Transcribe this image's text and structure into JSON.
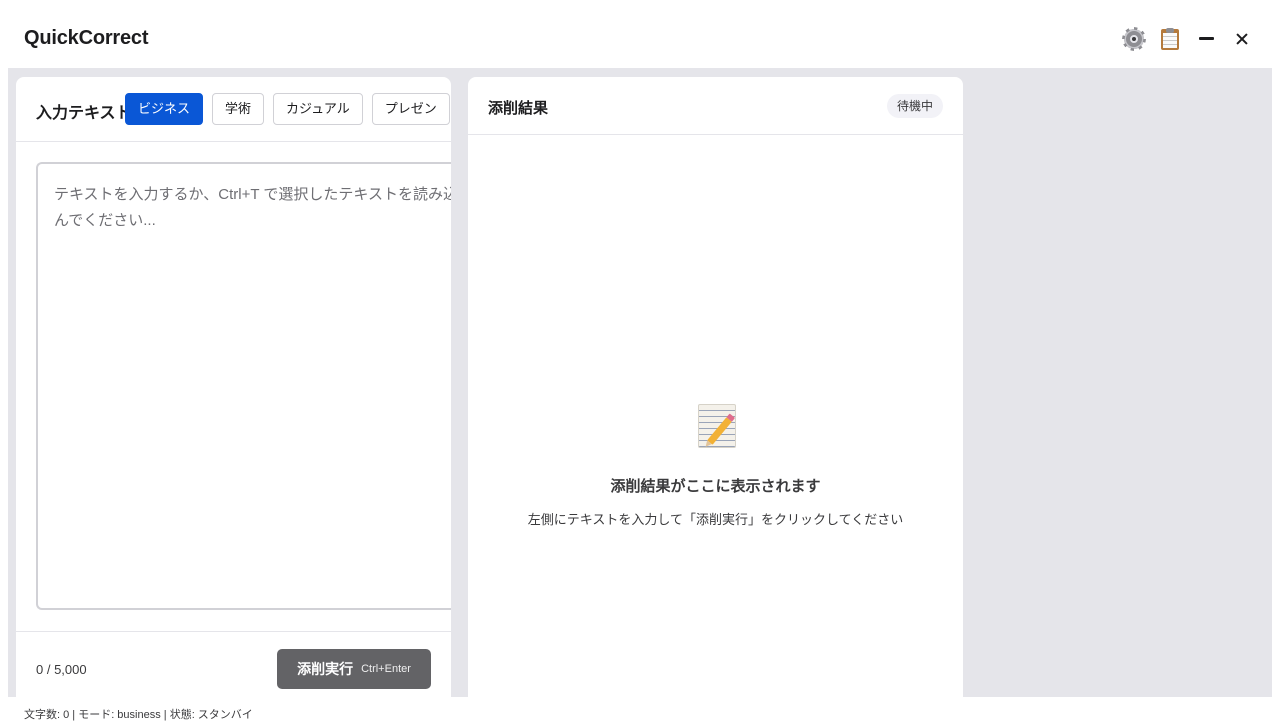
{
  "app": {
    "title": "QuickCorrect"
  },
  "title_icons": [
    "gear-icon",
    "clipboard-icon",
    "minimize-icon",
    "close-icon"
  ],
  "input_panel": {
    "title": "入力テキスト",
    "modes": [
      {
        "label": "ビジネス",
        "active": true
      },
      {
        "label": "学術",
        "active": false
      },
      {
        "label": "カジュアル",
        "active": false
      },
      {
        "label": "プレゼン",
        "active": false
      }
    ],
    "textarea": {
      "value": "",
      "placeholder": "テキストを入力するか、Ctrl+T で選択したテキストを読み込んでください..."
    },
    "char_count": "0 / 5,000",
    "submit_label": "添削実行",
    "submit_shortcut": "Ctrl+Enter"
  },
  "result_panel": {
    "title": "添削結果",
    "status": "待機中",
    "empty_icon": "memo-icon",
    "empty_title": "添削結果がここに表示されます",
    "empty_subtitle": "左側にテキストを入力して「添削実行」をクリックしてください"
  },
  "statusbar": {
    "text": "文字数: 0 | モード: business | 状態: スタンバイ"
  },
  "colors": {
    "accent": "#0a57d6",
    "workspace_bg": "#e5e5ea",
    "submit_disabled": "#636366"
  }
}
